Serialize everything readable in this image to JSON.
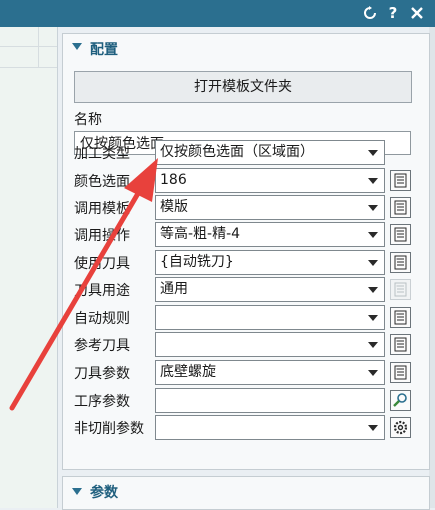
{
  "titlebar": {
    "refresh_icon": "refresh-icon",
    "help": "?",
    "close_icon": "close-icon"
  },
  "config_section": {
    "title": "配置",
    "open_folder_button": "打开模板文件夹",
    "name_label": "名称",
    "name_value": "仅按颜色选面",
    "rows": [
      {
        "label": "加工类型",
        "value": "仅按颜色选面（区域面）",
        "button": "none"
      },
      {
        "label": "颜色选面",
        "value": "186",
        "button": "list"
      },
      {
        "label": "调用模板",
        "value": "模版",
        "button": "list"
      },
      {
        "label": "调用操作",
        "value": "等高-粗-精-4",
        "button": "list"
      },
      {
        "label": "使用刀具",
        "value": "{自动铣刀}",
        "button": "list"
      },
      {
        "label": "刀具用途",
        "value": "通用",
        "button": "list-disabled"
      },
      {
        "label": "自动规则",
        "value": "",
        "button": "list"
      },
      {
        "label": "参考刀具",
        "value": "",
        "button": "list"
      },
      {
        "label": "刀具参数",
        "value": "底壁螺旋",
        "button": "list"
      },
      {
        "label": "工序参数",
        "value": "",
        "button": "search"
      },
      {
        "label": "非切削参数",
        "value": "",
        "button": "gear"
      }
    ]
  },
  "params_section": {
    "title": "参数"
  },
  "annotation": {
    "color": "#e8413c"
  }
}
